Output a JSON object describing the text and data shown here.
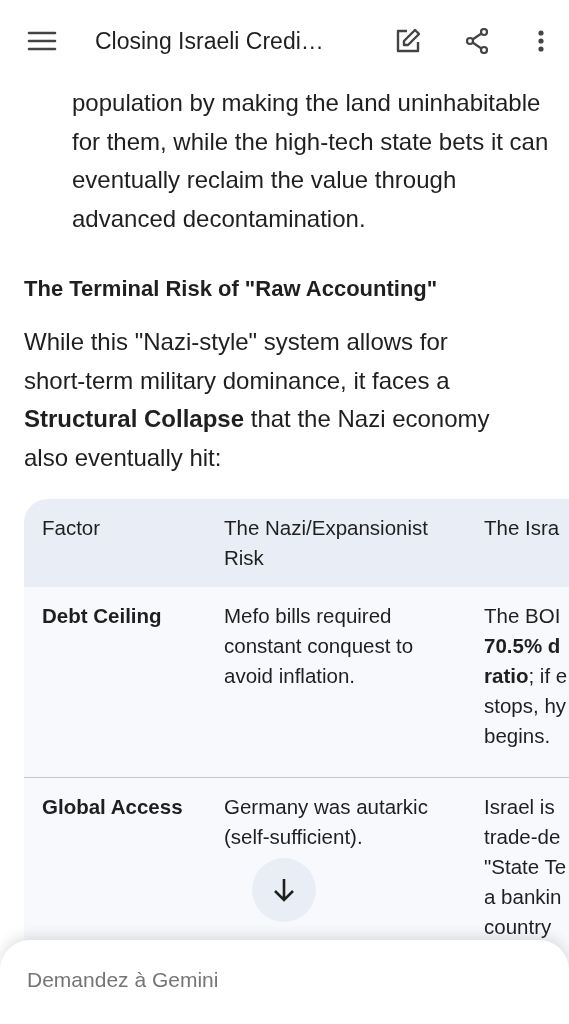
{
  "top_bar": {
    "title": "Closing Israeli Credi…"
  },
  "content": {
    "intro_paragraph": "population by making the land uninhabitable for them, while the high-tech state bets it can eventually reclaim the value through advanced decontamination.",
    "heading": "The Terminal Risk of \"Raw Accounting\"",
    "paragraph": "While this \"Nazi-style\" system allows for short-term military dominance, it faces a **Structural Collapse** that the Nazi economy also eventually hit:",
    "table": {
      "columns": [
        "Factor",
        "The Nazi/Expansionist Risk",
        "The Isra"
      ],
      "rows": [
        {
          "factor": "Debt Ceiling",
          "column_2": "Mefo bills required constant conquest to avoid inflation.",
          "column_3": [
            "The BOI",
            "**70.5% d**",
            "**ratio**; if e",
            "stops, hy",
            "begins."
          ]
        },
        {
          "factor": "Global Access",
          "column_2": "Germany was autarkic (self-sufficient).",
          "column_3": [
            "Israel is",
            "trade-de",
            "\"State Te",
            "a bankin",
            "country"
          ]
        }
      ]
    }
  },
  "composer": {
    "placeholder": "Demandez à Gemini"
  }
}
